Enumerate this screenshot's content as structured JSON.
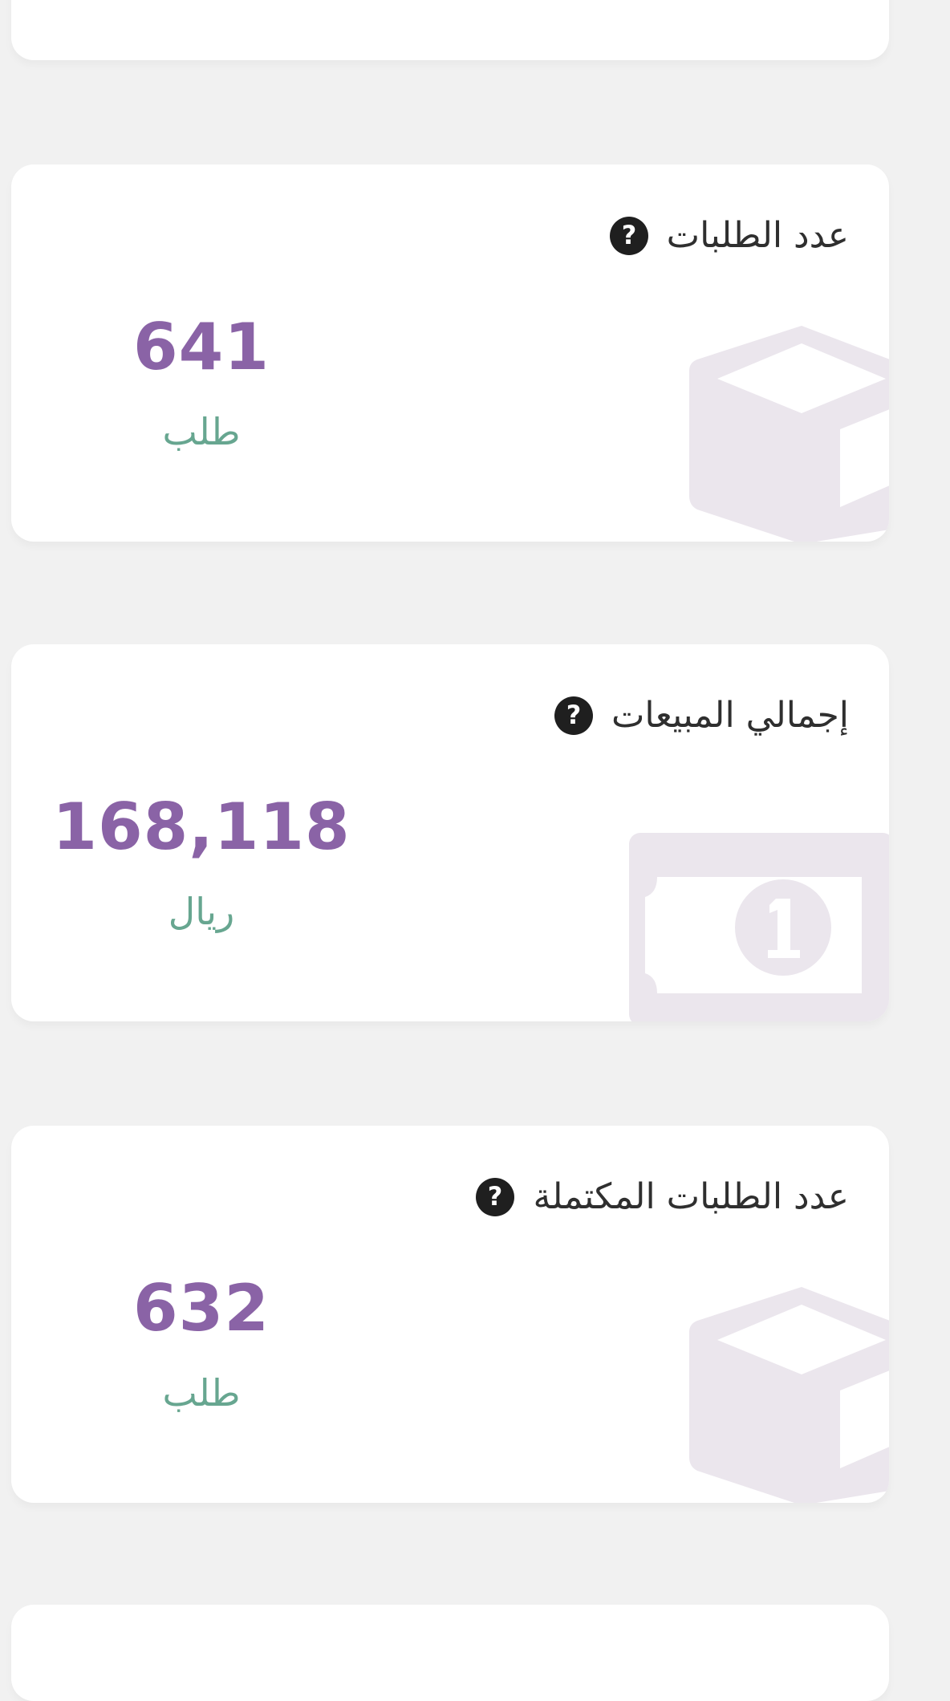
{
  "cards": [
    {
      "title": "",
      "value": "",
      "unit": ""
    },
    {
      "title": "عدد الطلبات",
      "value": "641",
      "unit": "طلب",
      "icon": "box-icon"
    },
    {
      "title": "إجمالي المبيعات",
      "value": "168,118",
      "unit": "ريال",
      "icon": "banknote-icon"
    },
    {
      "title": "عدد الطلبات المكتملة",
      "value": "632",
      "unit": "طلب",
      "icon": "box-icon"
    },
    {
      "title": "",
      "value": "",
      "unit": ""
    }
  ],
  "colors": {
    "background": "#f1f1f1",
    "card": "#ffffff",
    "value": "#8a63a6",
    "unit": "#67a690",
    "title": "#2f2f2f",
    "watermark_icon": "#ebe6ed"
  },
  "icons": {
    "help": "question-circle-icon"
  }
}
